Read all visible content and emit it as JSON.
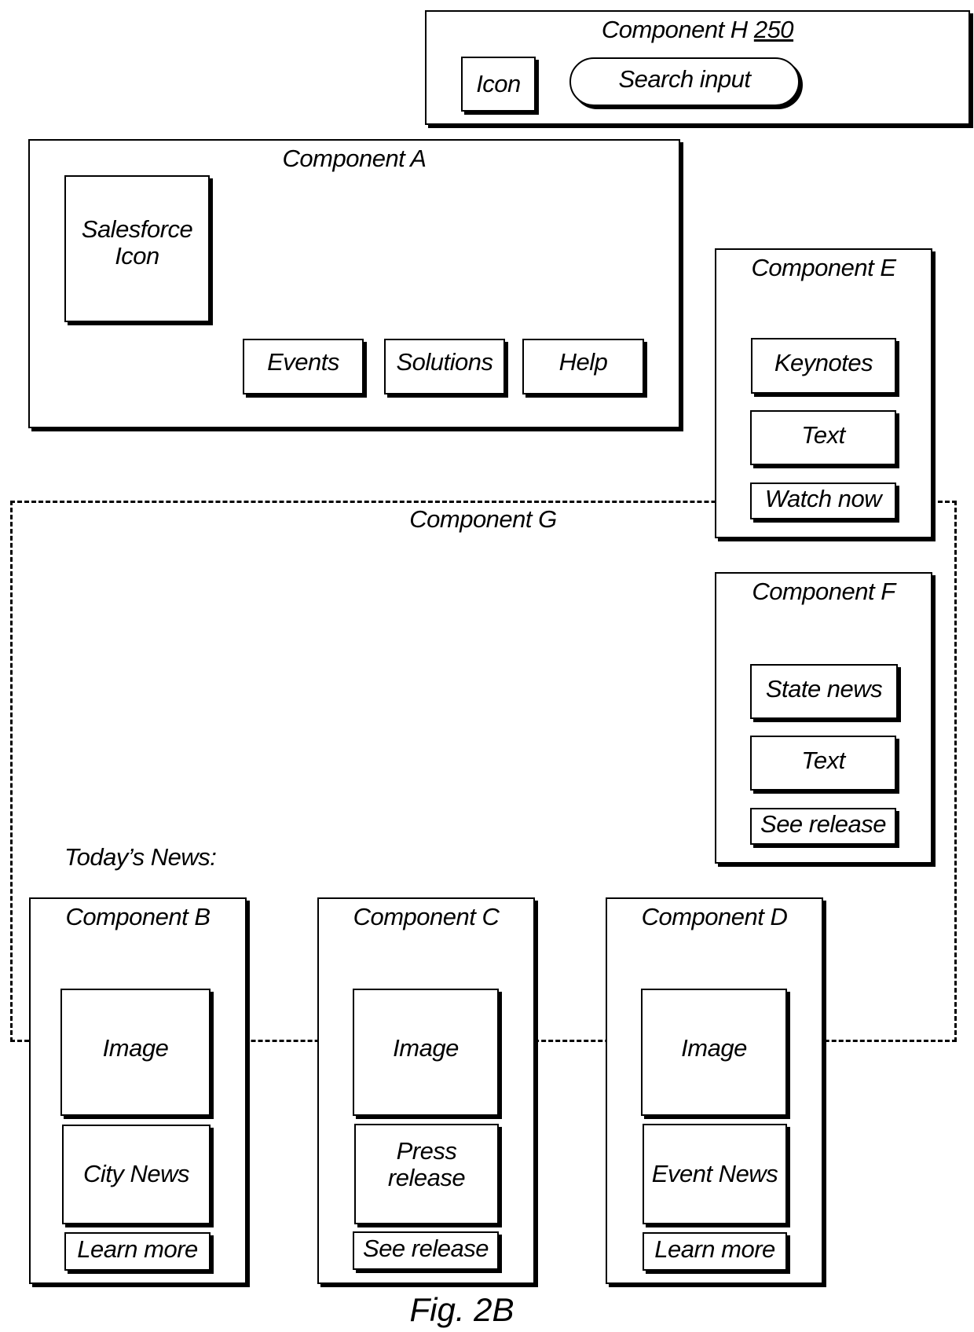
{
  "figure_label": "Fig. 2B",
  "component_h": {
    "title": "Component H",
    "ref_number": "250",
    "icon_label": "Icon",
    "search_label": "Search input"
  },
  "component_a": {
    "title": "Component A",
    "logo_label_line1": "Salesforce",
    "logo_label_line2": "Icon",
    "nav_items": [
      "Events",
      "Solutions",
      "Help"
    ]
  },
  "component_e": {
    "title": "Component E",
    "heading": "Keynotes",
    "text": "Text",
    "cta": "Watch now"
  },
  "component_f": {
    "title": "Component F",
    "heading": "State news",
    "text": "Text",
    "cta": "See release"
  },
  "component_g": {
    "title": "Component G",
    "section_heading": "Today’s News:"
  },
  "cards": [
    {
      "title": "Component B",
      "image_label": "Image",
      "text_line1": "City News",
      "text_line2": "",
      "cta": "Learn more"
    },
    {
      "title": "Component C",
      "image_label": "Image",
      "text_line1": "Press",
      "text_line2": "release",
      "cta": "See release"
    },
    {
      "title": "Component D",
      "image_label": "Image",
      "text_line1": "Event News",
      "text_line2": "",
      "cta": "Learn more"
    }
  ]
}
